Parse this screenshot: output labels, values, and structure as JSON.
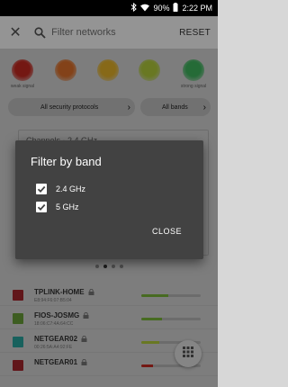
{
  "status_bar": {
    "battery": "90%",
    "time": "2:22 PM",
    "icons": [
      "bluetooth-icon",
      "wifi-icon",
      "battery-icon"
    ]
  },
  "toolbar": {
    "search_placeholder": "Filter networks",
    "reset_label": "RESET"
  },
  "signal_legend": {
    "weak_label": "weak signal",
    "strong_label": "strong signal",
    "colors": [
      "#c92a21",
      "#e2732b",
      "#e8b52a",
      "#b5cf3d",
      "#40b860"
    ]
  },
  "filters": {
    "security_label": "All security protocols",
    "bands_label": "All bands"
  },
  "background_panel": {
    "title": "Channels - 2.4 GHz"
  },
  "pager": {
    "count": 4,
    "active_index": 1
  },
  "networks": [
    {
      "ssid": "TPLINK-HOME",
      "mac": "E8:94:F6:07:B5:04",
      "checkbox_color": "#a8262e",
      "signal_color": "#7bb93a",
      "signal_level": 0.45
    },
    {
      "ssid": "FIOS-JOSMG",
      "mac": "18:06:C7:4A:64:CC",
      "checkbox_color": "#6aa03a",
      "signal_color": "#7bb93a",
      "signal_level": 0.35
    },
    {
      "ssid": "NETGEAR02",
      "mac": "00:26:5A:A4:92:FE",
      "checkbox_color": "#2aa8a0",
      "signal_color": "#b5cf3d",
      "signal_level": 0.3
    },
    {
      "ssid": "NETGEAR01",
      "mac": "",
      "checkbox_color": "#a8262e",
      "signal_color": "#c92a21",
      "signal_level": 0.2
    }
  ],
  "dialog": {
    "title": "Filter by band",
    "options": [
      {
        "label": "2.4 GHz",
        "checked": true
      },
      {
        "label": "5 GHz",
        "checked": true
      }
    ],
    "close_label": "CLOSE"
  },
  "colors": {
    "scrim": "#000000",
    "dialog_bg": "#424242",
    "toolbar_bg": "#ffffff"
  }
}
